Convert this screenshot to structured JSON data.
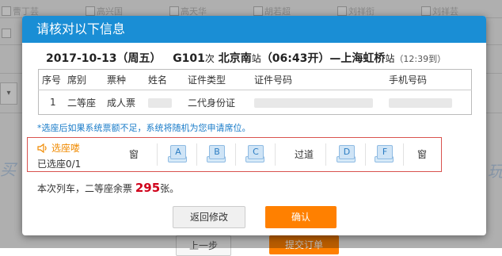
{
  "background": {
    "names": [
      "曹丁芸",
      "高兴国",
      "高天华",
      "胡若超",
      "刘祥衔",
      "刘祥芸"
    ],
    "side_text_left": "买",
    "side_text_right": "玩",
    "prev_button": "上一步",
    "submit_button": "提交订单"
  },
  "dialog": {
    "title": "请核对以下信息",
    "trip": {
      "date": "2017-10-13（周五）",
      "train": "G101",
      "train_suffix": "次",
      "from": "北京南",
      "from_suffix": "站",
      "depart": "（06:43开）",
      "dash": "—",
      "to": "上海虹桥",
      "to_suffix": "站",
      "arrive": "（12:39到）"
    },
    "table": {
      "headers": [
        "序号",
        "席别",
        "票种",
        "姓名",
        "证件类型",
        "证件号码",
        "手机号码"
      ],
      "row": {
        "index": "1",
        "seat_class": "二等座",
        "ticket_type": "成人票",
        "id_type": "二代身份证"
      }
    },
    "notice": "*选座后如果系统票额不足，系统将随机为您申请席位。",
    "seat_selection": {
      "title": "选座喽",
      "selected": "已选座0/1",
      "window_label": "窗",
      "aisle_label": "过道",
      "seats_left": [
        "A",
        "B",
        "C"
      ],
      "seats_right": [
        "D",
        "F"
      ]
    },
    "remaining": {
      "prefix": "本次列车，二等座余票",
      "count": "295",
      "suffix": "张。"
    },
    "buttons": {
      "back": "返回修改",
      "confirm": "确认"
    }
  },
  "colors": {
    "title_bar": "#1a8ed5",
    "confirm": "#ff8000",
    "notice": "#1a7cc9",
    "remaining_count": "#d0021b",
    "seat_box_border": "#d9534f"
  }
}
